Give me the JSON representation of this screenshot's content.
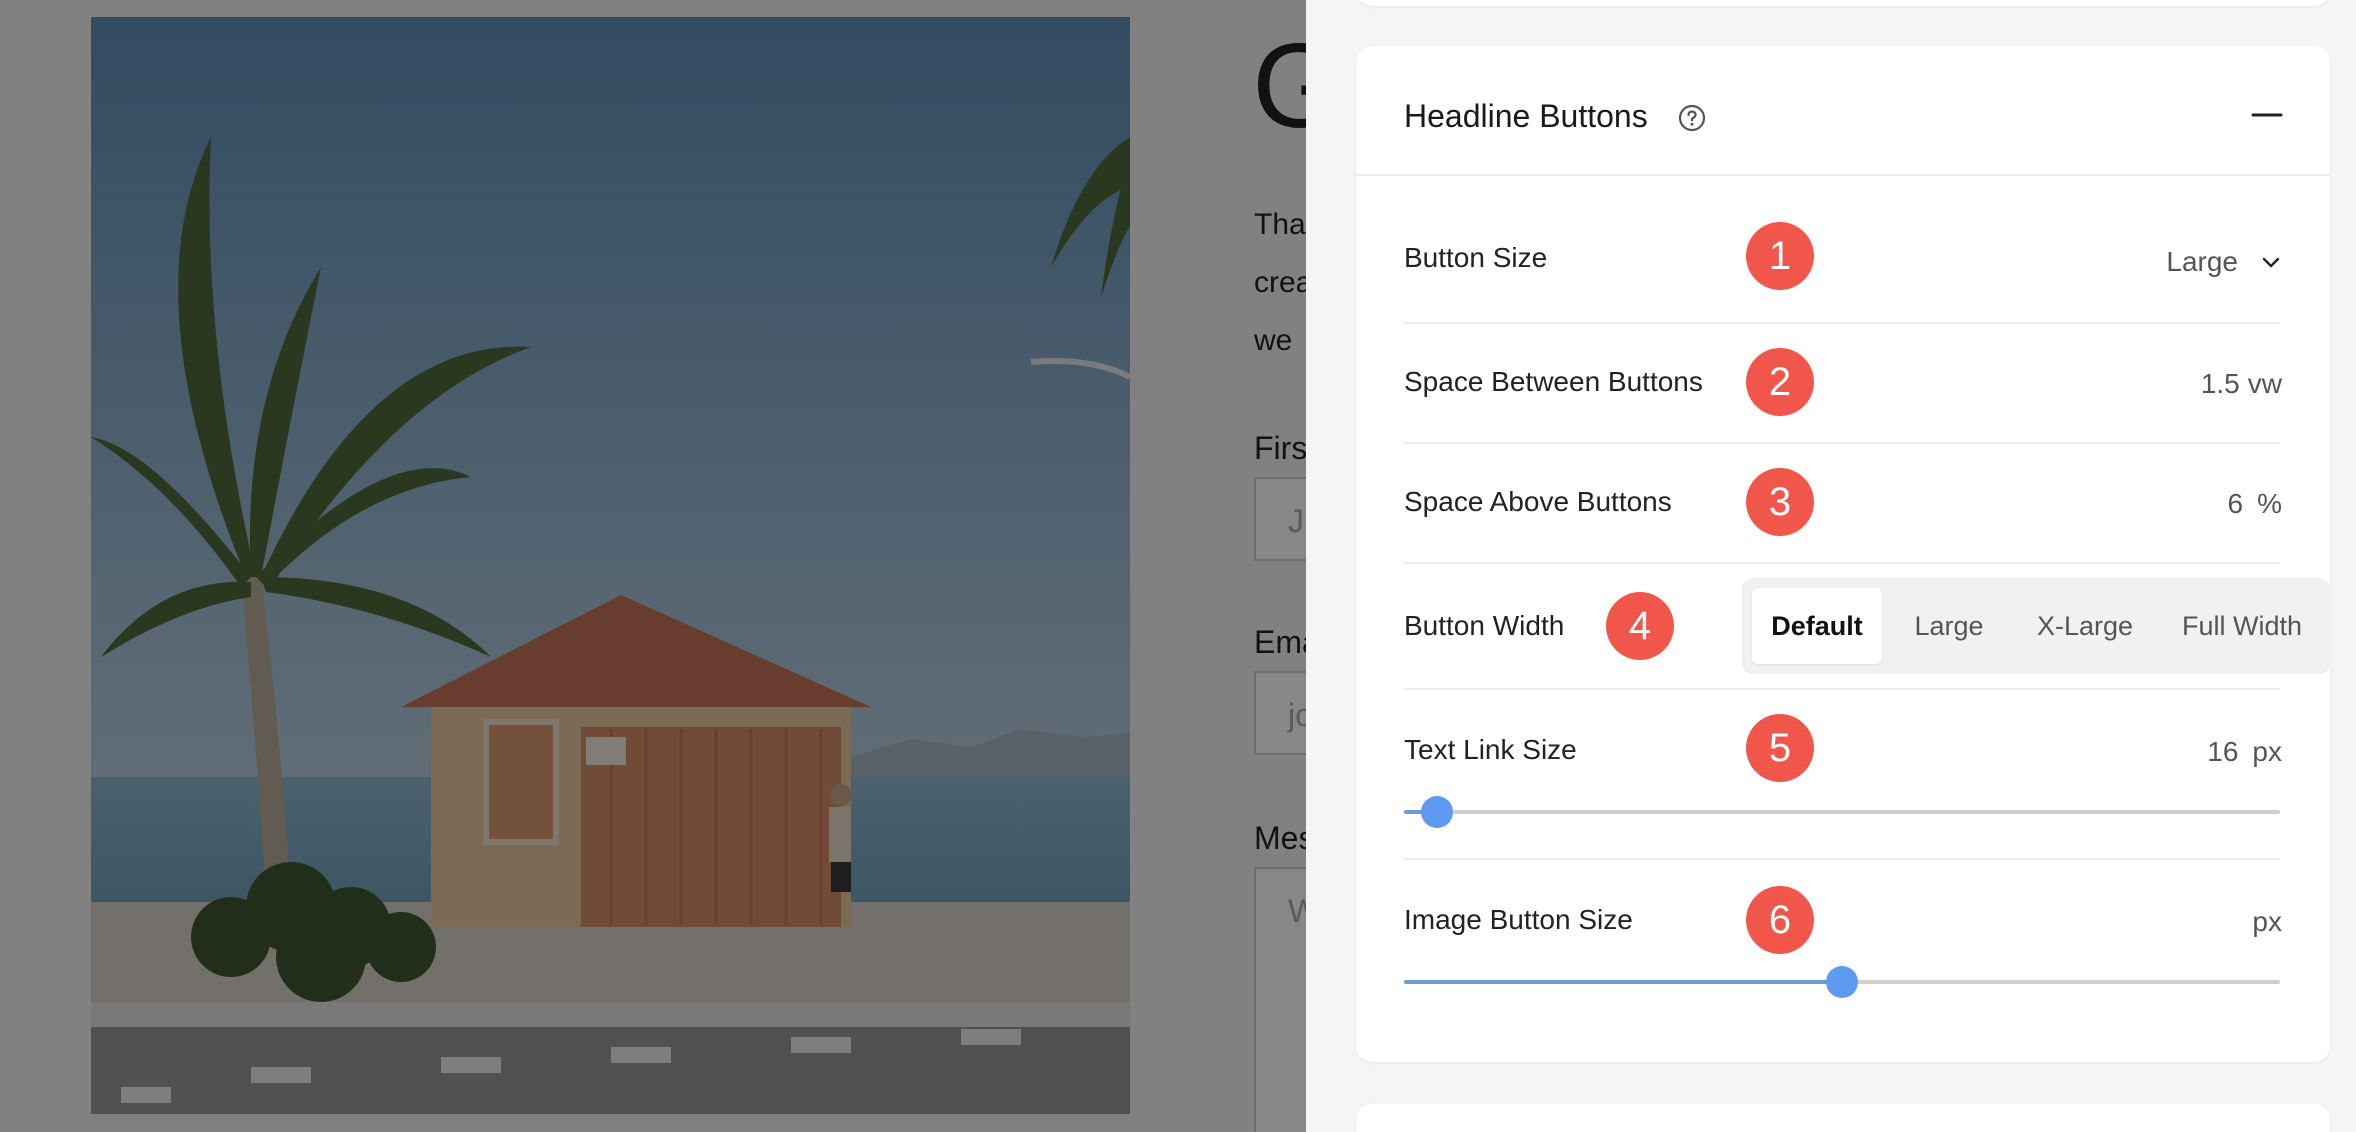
{
  "preview": {
    "heading": "G",
    "paragraph_lines": [
      "Tha",
      "crea",
      "we"
    ],
    "fields": [
      {
        "label": "Firs",
        "placeholder": "J"
      },
      {
        "label": "Ema",
        "placeholder": "jo"
      },
      {
        "label": "Mes",
        "placeholder": "W"
      }
    ]
  },
  "panel": {
    "section_title": "Headline Buttons",
    "help_icon": "question-circle-icon",
    "collapse_icon": "minus-icon",
    "badge_color": "#f0574a",
    "accent_color": "#5e9af0",
    "rows": {
      "button_size": {
        "label": "Button Size",
        "badge": "1",
        "value": "Large"
      },
      "space_between": {
        "label": "Space Between Buttons",
        "badge": "2",
        "value": "1.5",
        "unit": "vw"
      },
      "space_above": {
        "label": "Space Above Buttons",
        "badge": "3",
        "value": "6",
        "unit": "%"
      },
      "button_width": {
        "label": "Button Width",
        "badge": "4",
        "options": [
          "Default",
          "Large",
          "X-Large",
          "Full Width"
        ],
        "selected": "Default"
      },
      "text_link_size": {
        "label": "Text Link Size",
        "badge": "5",
        "value": "16",
        "unit": "px",
        "slider_fraction": 0.038
      },
      "image_button_size": {
        "label": "Image Button Size",
        "badge": "6",
        "value": "",
        "unit": "px",
        "slider_fraction": 0.5
      }
    }
  }
}
